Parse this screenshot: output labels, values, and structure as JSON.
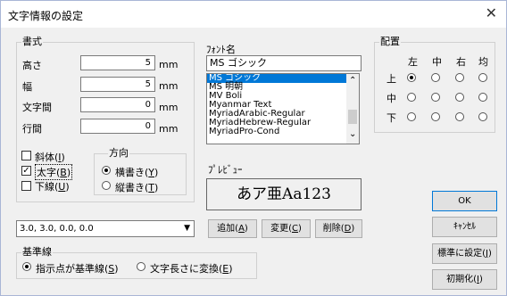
{
  "window": {
    "title": "文字情報の設定",
    "close_glyph": "✕"
  },
  "format_group": {
    "label": "書式",
    "fields": [
      {
        "label": "高さ",
        "value": "5",
        "unit": "mm"
      },
      {
        "label": "幅",
        "value": "5",
        "unit": "mm"
      },
      {
        "label": "文字間",
        "value": "0",
        "unit": "mm"
      },
      {
        "label": "行間",
        "value": "0",
        "unit": "mm"
      }
    ],
    "italic": {
      "label": "斜体(",
      "key": "I",
      "suffix": ")",
      "checked": false
    },
    "bold": {
      "label": "太字(",
      "key": "B",
      "suffix": ")",
      "checked": true
    },
    "underline": {
      "label": "下線(",
      "key": "U",
      "suffix": ")",
      "checked": false
    },
    "check_glyph": "✓",
    "direction": {
      "label": "方向",
      "horizontal": {
        "label": "横書き(",
        "key": "Y",
        "suffix": ")",
        "selected": true
      },
      "vertical": {
        "label": "縦書き(",
        "key": "T",
        "suffix": ")",
        "selected": false
      }
    }
  },
  "font": {
    "label": "ﾌｫﾝﾄ名",
    "current": "MS ゴシック",
    "list": [
      "MS ゴシック",
      "MS 明朝",
      "MV Boli",
      "Myanmar Text",
      "MyriadArabic-Regular",
      "MyriadHebrew-Regular",
      "MyriadPro-Cond"
    ],
    "selected_index": 0,
    "scroll_up": "⌃",
    "scroll_down": "⌄"
  },
  "placement": {
    "label": "配置",
    "columns": [
      "左",
      "中",
      "右",
      "均"
    ],
    "rows": [
      "上",
      "中",
      "下"
    ],
    "selected": [
      0,
      0
    ]
  },
  "preview": {
    "label": "ﾌﾟﾚﾋﾞｭｰ",
    "text": "あア亜Aa123"
  },
  "combo": {
    "value": "3.0,  3.0,  0.0,  0.0",
    "arrow": "▼"
  },
  "buttons": {
    "add": {
      "label": "追加(",
      "key": "A",
      "suffix": ")"
    },
    "change": {
      "label": "変更(",
      "key": "C",
      "suffix": ")"
    },
    "delete": {
      "label": "削除(",
      "key": "D",
      "suffix": ")"
    },
    "ok": "OK",
    "cancel": "ｷｬﾝｾﾙ",
    "set_default": {
      "label": "標準に設定(",
      "key": "J",
      "suffix": ")"
    },
    "initialize": {
      "label": "初期化(",
      "key": "I",
      "suffix": ")"
    }
  },
  "baseline": {
    "label": "基準線",
    "point": {
      "label": "指示点が基準線(",
      "key": "S",
      "suffix": ")",
      "selected": true
    },
    "length": {
      "label": "文字長さに変換(",
      "key": "E",
      "suffix": ")",
      "selected": false
    }
  }
}
